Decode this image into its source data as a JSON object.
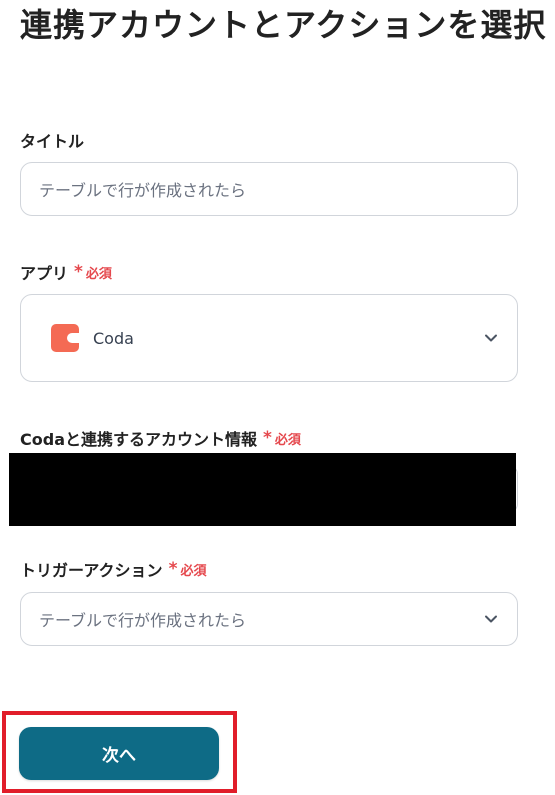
{
  "page": {
    "title": "連携アカウントとアクションを選択"
  },
  "form": {
    "title_field": {
      "label": "タイトル",
      "value": "テーブルで行が作成されたら"
    },
    "app_field": {
      "label": "アプリ",
      "required_mark": "*",
      "required_text": "必須",
      "selected": "Coda",
      "icon": "coda-icon",
      "icon_color": "#f46a54"
    },
    "account_field": {
      "label": "Codaと連携するアカウント情報",
      "required_mark": "*",
      "required_text": "必須"
    },
    "trigger_field": {
      "label": "トリガーアクション",
      "required_mark": "*",
      "required_text": "必須",
      "selected": "テーブルで行が作成されたら"
    }
  },
  "actions": {
    "next_label": "次へ"
  },
  "colors": {
    "primary_button": "#0e6b86",
    "required": "#e5484d",
    "highlight": "#e11d2a"
  }
}
